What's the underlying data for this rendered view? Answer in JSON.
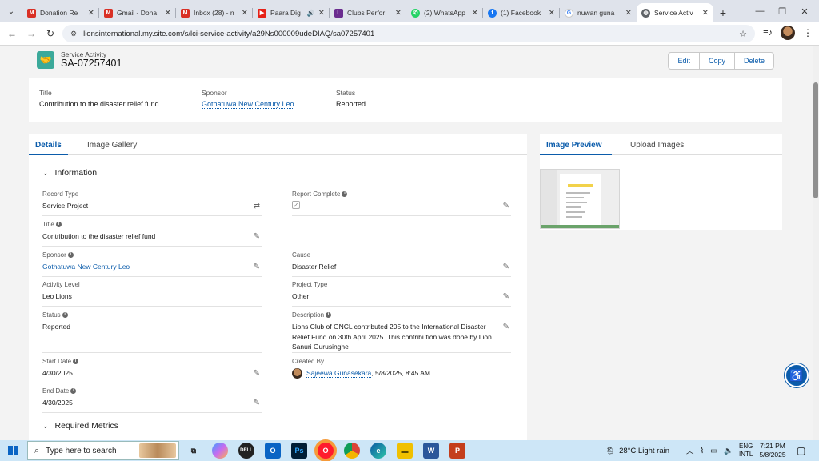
{
  "browser": {
    "tabs": [
      {
        "title": "Donation Re",
        "icon": "gmail-icon",
        "color": "#d93025"
      },
      {
        "title": "Gmail - Dona",
        "icon": "gmail-icon",
        "color": "#d93025"
      },
      {
        "title": "Inbox (28) - n",
        "icon": "gmail-icon",
        "color": "#d93025"
      },
      {
        "title": "Paara Dig",
        "icon": "youtube-icon",
        "color": "#e62117"
      },
      {
        "title": "Clubs Perfor",
        "icon": "lions-icon",
        "color": "#6b2c8f"
      },
      {
        "title": "(2) WhatsApp",
        "icon": "whatsapp-icon",
        "color": "#25d366"
      },
      {
        "title": "(1) Facebook",
        "icon": "facebook-icon",
        "color": "#1877f2"
      },
      {
        "title": "nuwan guna",
        "icon": "google-icon",
        "color": "#4285f4"
      },
      {
        "title": "Service Activ",
        "icon": "globe-icon",
        "color": "#5f6368"
      }
    ],
    "url": "lionsinternational.my.site.com/s/lci-service-activity/a29Ns000009udeDIAQ/sa07257401"
  },
  "record": {
    "object_type": "Service Activity",
    "name": "SA-07257401",
    "actions": [
      "Edit",
      "Copy",
      "Delete"
    ]
  },
  "highlights": {
    "title_label": "Title",
    "title_value": "Contribution to the disaster relief fund",
    "sponsor_label": "Sponsor",
    "sponsor_value": "Gothatuwa New Century Leo",
    "status_label": "Status",
    "status_value": "Reported"
  },
  "left_tabs": [
    "Details",
    "Image Gallery"
  ],
  "right_tabs": [
    "Image Preview",
    "Upload Images"
  ],
  "sections": {
    "information": "Information",
    "required_metrics": "Required Metrics"
  },
  "fields": {
    "record_type": {
      "label": "Record Type",
      "value": "Service Project"
    },
    "report_complete": {
      "label": "Report Complete",
      "value": "✓"
    },
    "title": {
      "label": "Title",
      "value": "Contribution to the disaster relief fund"
    },
    "sponsor": {
      "label": "Sponsor",
      "value": "Gothatuwa New Century Leo"
    },
    "cause": {
      "label": "Cause",
      "value": "Disaster Relief"
    },
    "activity_level": {
      "label": "Activity Level",
      "value": "Leo Lions"
    },
    "project_type": {
      "label": "Project Type",
      "value": "Other"
    },
    "status": {
      "label": "Status",
      "value": "Reported"
    },
    "description": {
      "label": "Description",
      "value": "Lions Club of GNCL contributed 205 to the International Disaster Relief Fund on 30th April 2025. This contribution was done by Lion Sanuri Gurusinghe"
    },
    "start_date": {
      "label": "Start Date",
      "value": "4/30/2025"
    },
    "created_by": {
      "label": "Created By",
      "user": "Sajeewa Gunasekara",
      "timestamp": ", 5/8/2025, 8:45 AM"
    },
    "end_date": {
      "label": "End Date",
      "value": "4/30/2025"
    }
  },
  "taskbar": {
    "search_placeholder": "Type here to search",
    "weather": "28°C  Light rain",
    "lang1": "ENG",
    "lang2": "INTL",
    "time": "7:21 PM",
    "date": "5/8/2025"
  },
  "colors": {
    "brand": "#0b5cab",
    "object_icon": "#3ba99a"
  }
}
